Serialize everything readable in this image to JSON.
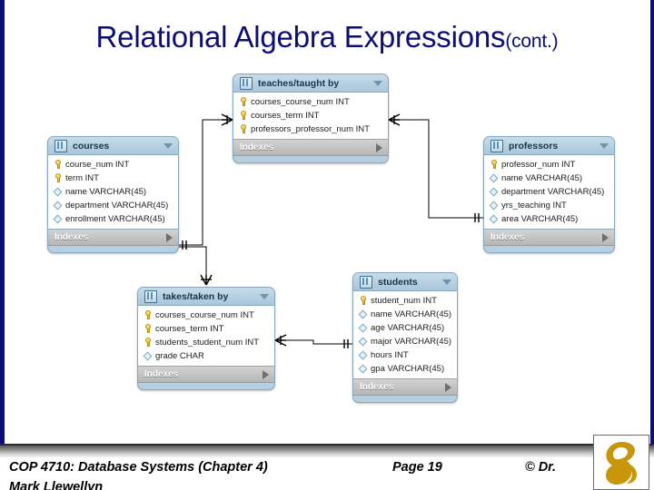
{
  "slide": {
    "title_main": "Relational Algebra Expressions",
    "title_sub": "(cont.)",
    "accent_color": "#0d0d78"
  },
  "diagram": {
    "type": "er-diagram",
    "entities": [
      {
        "id": "courses",
        "name": "courses",
        "icon": "table-icon",
        "caret": "chevron-down-icon",
        "indexes_label": "Indexes",
        "indexes_caret": "chevron-right-icon",
        "fields": [
          {
            "icon": "key-icon",
            "text": "course_num INT"
          },
          {
            "icon": "key-icon",
            "text": "term INT"
          },
          {
            "icon": "diamond-icon",
            "text": "name VARCHAR(45)"
          },
          {
            "icon": "diamond-icon",
            "text": "department VARCHAR(45)"
          },
          {
            "icon": "diamond-icon",
            "text": "enrollment VARCHAR(45)"
          }
        ]
      },
      {
        "id": "teaches",
        "name": "teaches/taught by",
        "icon": "table-icon",
        "caret": "chevron-down-icon",
        "indexes_label": "Indexes",
        "indexes_caret": "chevron-right-icon",
        "fields": [
          {
            "icon": "key-icon",
            "text": "courses_course_num INT"
          },
          {
            "icon": "key-icon",
            "text": "courses_term INT"
          },
          {
            "icon": "key-icon",
            "text": "professors_professor_num INT"
          }
        ]
      },
      {
        "id": "professors",
        "name": "professors",
        "icon": "table-icon",
        "caret": "chevron-down-icon",
        "indexes_label": "Indexes",
        "indexes_caret": "chevron-right-icon",
        "fields": [
          {
            "icon": "key-icon",
            "text": "professor_num INT"
          },
          {
            "icon": "diamond-icon",
            "text": "name VARCHAR(45)"
          },
          {
            "icon": "diamond-icon",
            "text": "department VARCHAR(45)"
          },
          {
            "icon": "diamond-icon",
            "text": "yrs_teaching INT"
          },
          {
            "icon": "diamond-icon",
            "text": "area VARCHAR(45)"
          }
        ]
      },
      {
        "id": "takes",
        "name": "takes/taken by",
        "icon": "table-icon",
        "caret": "chevron-down-icon",
        "indexes_label": "Indexes",
        "indexes_caret": "chevron-right-icon",
        "fields": [
          {
            "icon": "key-icon",
            "text": "courses_course_num INT"
          },
          {
            "icon": "key-icon",
            "text": "courses_term INT"
          },
          {
            "icon": "key-icon",
            "text": "students_student_num INT"
          },
          {
            "icon": "diamond-icon",
            "text": "grade CHAR"
          }
        ]
      },
      {
        "id": "students",
        "name": "students",
        "icon": "table-icon",
        "caret": "chevron-down-icon",
        "indexes_label": "Indexes",
        "indexes_caret": "chevron-right-icon",
        "fields": [
          {
            "icon": "key-icon",
            "text": "student_num INT"
          },
          {
            "icon": "diamond-icon",
            "text": "name VARCHAR(45)"
          },
          {
            "icon": "diamond-icon",
            "text": "age VARCHAR(45)"
          },
          {
            "icon": "diamond-icon",
            "text": "major VARCHAR(45)"
          },
          {
            "icon": "diamond-icon",
            "text": "hours INT"
          },
          {
            "icon": "diamond-icon",
            "text": "gpa VARCHAR(45)"
          }
        ]
      }
    ],
    "relationships": [
      {
        "from": "courses",
        "to": "teaches",
        "from_card": "one",
        "to_card": "many"
      },
      {
        "from": "professors",
        "to": "teaches",
        "from_card": "one",
        "to_card": "many"
      },
      {
        "from": "courses",
        "to": "takes",
        "from_card": "one",
        "to_card": "many"
      },
      {
        "from": "students",
        "to": "takes",
        "from_card": "one",
        "to_card": "many"
      }
    ]
  },
  "footer": {
    "course": "COP 4710: Database Systems  (Chapter 4)",
    "page": "Page 19",
    "copyright": "© Dr.",
    "author": "Mark Llewellyn",
    "logo": "pegasus-logo"
  }
}
